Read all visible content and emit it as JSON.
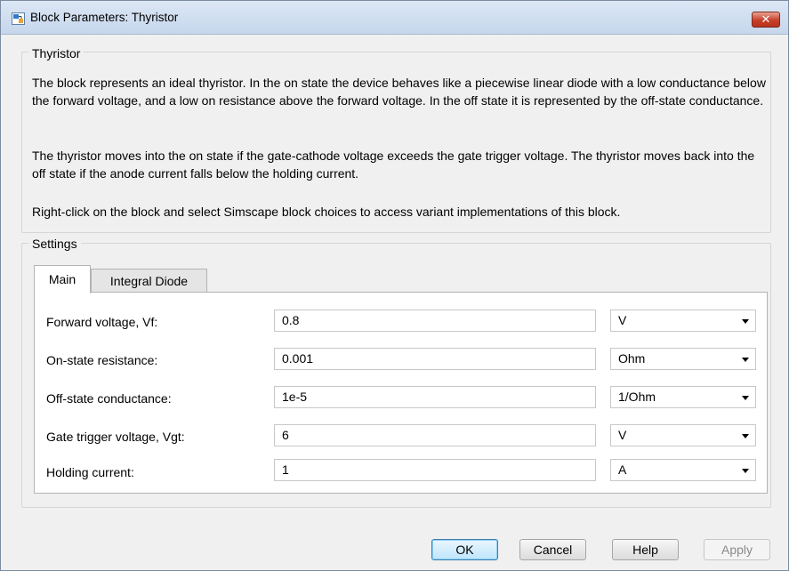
{
  "window": {
    "title": "Block Parameters: Thyristor",
    "close_label": "✕"
  },
  "block_group": {
    "label": "Thyristor",
    "paragraphs": [
      "The block represents an ideal thyristor. In the on state the device behaves like a piecewise linear diode with a low conductance below the forward voltage, and a low on resistance above the forward voltage. In the off state it is represented by the off-state conductance.",
      "The thyristor moves into the on state if the gate-cathode voltage exceeds the gate trigger voltage. The thyristor moves back into the off state if the anode current falls below the holding current.",
      "Right-click on the block and select Simscape block choices to access variant implementations of this block."
    ]
  },
  "settings": {
    "label": "Settings",
    "tabs": [
      {
        "label": "Main",
        "active": true
      },
      {
        "label": "Integral Diode",
        "active": false
      }
    ],
    "params": [
      {
        "label": "Forward voltage, Vf:",
        "value": "0.8",
        "unit": "V"
      },
      {
        "label": "On-state resistance:",
        "value": "0.001",
        "unit": "Ohm"
      },
      {
        "label": "Off-state conductance:",
        "value": "1e-5",
        "unit": "1/Ohm"
      },
      {
        "label": "Gate trigger voltage, Vgt:",
        "value": "6",
        "unit": "V"
      },
      {
        "label": "Holding current:",
        "value": "1",
        "unit": "A"
      }
    ]
  },
  "buttons": {
    "ok": "OK",
    "cancel": "Cancel",
    "help": "Help",
    "apply": "Apply"
  },
  "icons": {
    "app": "simulink-block-icon",
    "close": "close-icon",
    "dropdown": "chevron-down-icon"
  }
}
